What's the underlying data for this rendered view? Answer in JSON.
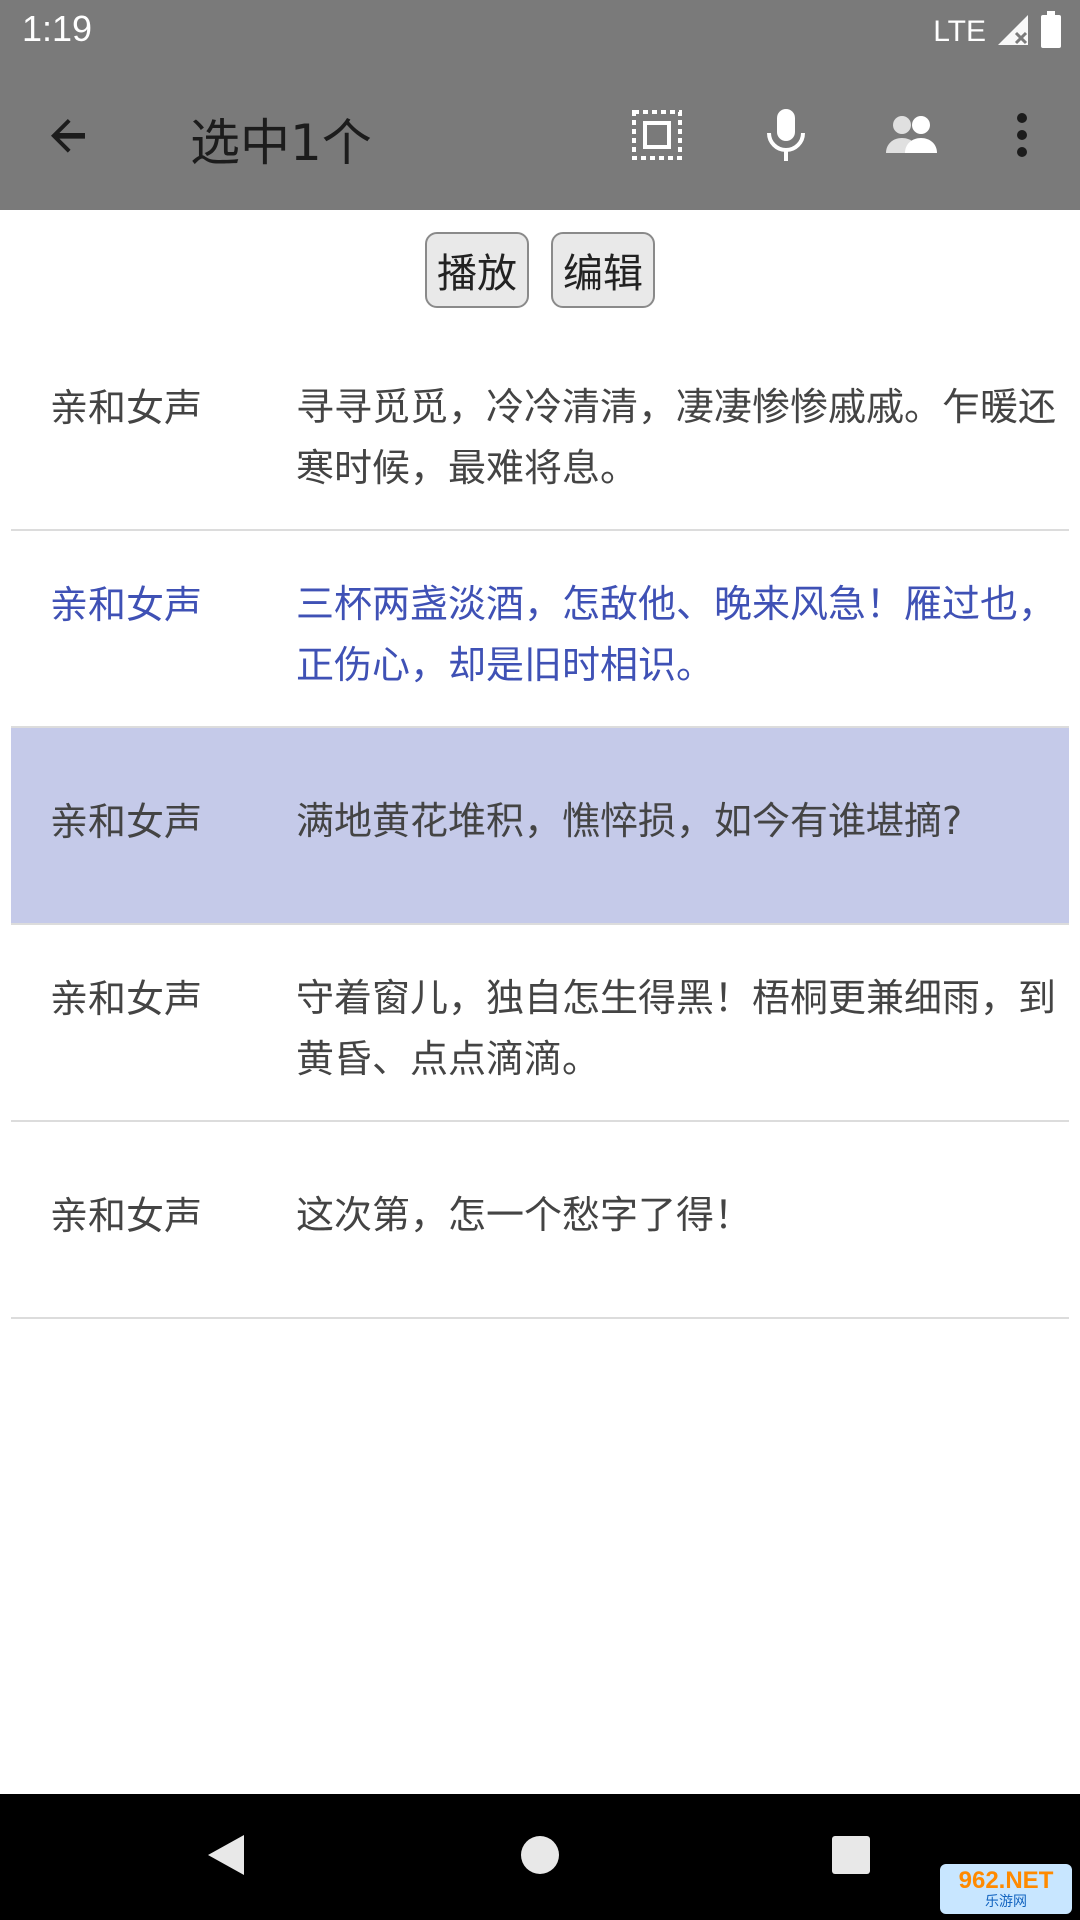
{
  "status_bar": {
    "time": "1:19",
    "network": "LTE",
    "icons": [
      "signal-icon",
      "battery-icon"
    ]
  },
  "toolbar": {
    "title": "选中1个",
    "icons": [
      "arrow-back-icon",
      "select-all-icon",
      "microphone-icon",
      "speakers-icon",
      "more-vert-icon"
    ]
  },
  "actions": {
    "play_label": "播放",
    "edit_label": "编辑"
  },
  "rows": [
    {
      "voice": "亲和女声",
      "text": "寻寻觅觅，冷冷清清，凄凄惨惨戚戚。乍暖还寒时候，最难将息。",
      "state": "normal"
    },
    {
      "voice": "亲和女声",
      "text": "三杯两盏淡酒，怎敌他、晚来风急！雁过也，正伤心，却是旧时相识。",
      "state": "highlighted"
    },
    {
      "voice": "亲和女声",
      "text": "满地黄花堆积，憔悴损，如今有谁堪摘?",
      "state": "selected"
    },
    {
      "voice": "亲和女声",
      "text": "守着窗儿，独自怎生得黑！梧桐更兼细雨，到黄昏、点点滴滴。",
      "state": "normal"
    },
    {
      "voice": "亲和女声",
      "text": "这次第，怎一个愁字了得！",
      "state": "normal"
    }
  ],
  "colors": {
    "toolbar_bg": "#7a7a7a",
    "selected_row_bg": "#c5cae9",
    "highlight_text": "#3f51b5"
  },
  "nav_bar": {
    "icons": [
      "nav-back-icon",
      "nav-home-icon",
      "nav-recents-icon"
    ]
  },
  "watermark": {
    "top": "962.NET",
    "bottom": "乐游网"
  }
}
